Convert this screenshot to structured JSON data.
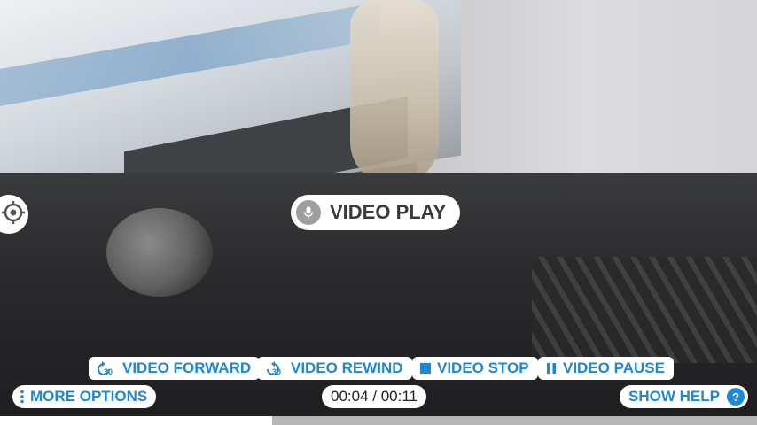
{
  "voice_command": {
    "label": "VIDEO PLAY",
    "icon": "microphone-icon"
  },
  "controls": {
    "forward": {
      "label": "VIDEO FORWARD",
      "icon": "forward-30-icon"
    },
    "rewind": {
      "label": "VIDEO REWIND",
      "icon": "rewind-30-icon"
    },
    "stop": {
      "label": "VIDEO STOP",
      "icon": "stop-icon"
    },
    "pause": {
      "label": "VIDEO PAUSE",
      "icon": "pause-icon"
    }
  },
  "more_options": {
    "label": "MORE OPTIONS",
    "icon": "more-vertical-icon"
  },
  "time": {
    "display": "00:04 / 00:11"
  },
  "help": {
    "label": "SHOW HELP",
    "badge": "?"
  },
  "progress": {
    "fraction": 0.36
  },
  "colors": {
    "accent": "#1e88d6",
    "pill_bg": "#ffffff",
    "progress_played": "#ffffff",
    "progress_remaining": "#b6b6b6"
  }
}
